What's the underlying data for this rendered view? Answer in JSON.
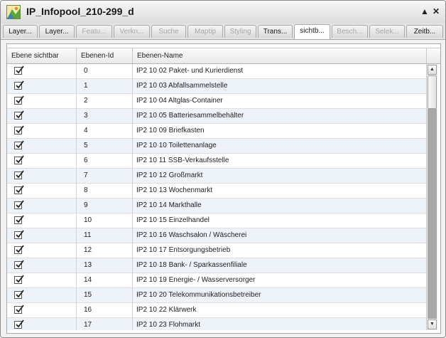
{
  "window": {
    "title": "IP_Infopool_210-299_d",
    "icon": "map-layer-icon",
    "minimize_glyph": "▲",
    "close_glyph": "✕"
  },
  "tabs": [
    {
      "label": "Layer...",
      "state": "normal"
    },
    {
      "label": "Layer...",
      "state": "normal"
    },
    {
      "label": "Featu...",
      "state": "disabled"
    },
    {
      "label": "Verkn...",
      "state": "disabled"
    },
    {
      "label": "Suche",
      "state": "disabled"
    },
    {
      "label": "Maptip",
      "state": "disabled"
    },
    {
      "label": "Styling",
      "state": "disabled"
    },
    {
      "label": "Trans...",
      "state": "normal"
    },
    {
      "label": "sichtb...",
      "state": "active"
    },
    {
      "label": "Besch...",
      "state": "disabled"
    },
    {
      "label": "Selek...",
      "state": "disabled"
    },
    {
      "label": "Zeitb...",
      "state": "normal"
    }
  ],
  "table": {
    "columns": [
      "Ebene sichtbar",
      "Ebenen-Id",
      "Ebenen-Name"
    ],
    "rows": [
      {
        "visible": true,
        "id": "0",
        "name": "IP2 10 02 Paket- und Kurierdienst"
      },
      {
        "visible": true,
        "id": "1",
        "name": "IP2 10 03 Abfallsammelstelle"
      },
      {
        "visible": true,
        "id": "2",
        "name": "IP2 10 04 Altglas-Container"
      },
      {
        "visible": true,
        "id": "3",
        "name": "IP2 10 05 Batteriesammelbehälter"
      },
      {
        "visible": true,
        "id": "4",
        "name": "IP2 10 09 Briefkasten"
      },
      {
        "visible": true,
        "id": "5",
        "name": "IP2 10 10 Toilettenanlage"
      },
      {
        "visible": true,
        "id": "6",
        "name": "IP2 10 11 SSB-Verkaufsstelle"
      },
      {
        "visible": true,
        "id": "7",
        "name": "IP2 10 12 Großmarkt"
      },
      {
        "visible": true,
        "id": "8",
        "name": "IP2 10 13 Wochenmarkt"
      },
      {
        "visible": true,
        "id": "9",
        "name": "IP2 10 14 Markthalle"
      },
      {
        "visible": true,
        "id": "10",
        "name": "IP2 10 15 Einzelhandel"
      },
      {
        "visible": true,
        "id": "11",
        "name": "IP2 10 16 Waschsalon / Wäscherei"
      },
      {
        "visible": true,
        "id": "12",
        "name": "IP2 10 17 Entsorgungsbetrieb"
      },
      {
        "visible": true,
        "id": "13",
        "name": "IP2 10 18 Bank- / Sparkassenfiliale"
      },
      {
        "visible": true,
        "id": "14",
        "name": "IP2 10 19 Energie- / Wasserversorger"
      },
      {
        "visible": true,
        "id": "15",
        "name": "IP2 10 20 Telekommunikationsbetreiber"
      },
      {
        "visible": true,
        "id": "16",
        "name": "IP2 10 22 Klärwerk"
      },
      {
        "visible": true,
        "id": "17",
        "name": "IP2 10 23 Flohmarkt"
      }
    ]
  },
  "scrollbar": {
    "up_glyph": "▲",
    "down_glyph": "▼"
  },
  "colors": {
    "alt_row": "#eef3fa",
    "track": "#a8a8a8"
  }
}
